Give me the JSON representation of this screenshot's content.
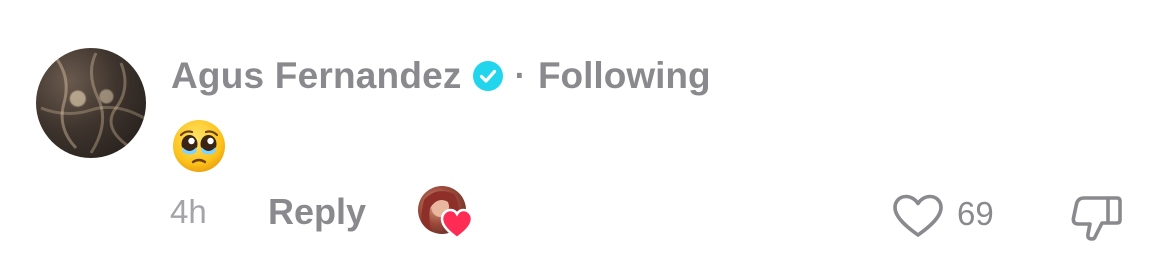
{
  "comment": {
    "author": {
      "name": "Agus Fernandez",
      "verified": true,
      "relationship": "Following",
      "separator": "·",
      "avatar_icon": "user-avatar-photo"
    },
    "content": {
      "emoji": "🥹",
      "emoji_icon": "pleading-face-holding-tears-emoji"
    },
    "meta": {
      "timestamp": "4h",
      "reply_label": "Reply",
      "creator_liked": true,
      "creator_like_icon": "creator-avatar-with-heart"
    },
    "actions": {
      "like_icon": "heart-outline-icon",
      "like_count": "69",
      "dislike_icon": "thumbs-down-outline-icon"
    }
  },
  "colors": {
    "text_primary_gray": "#8a8a8e",
    "text_secondary_gray": "#a3a3a8",
    "verified_badge": "#20d5ec",
    "heart_badge": "#fe2c55"
  }
}
